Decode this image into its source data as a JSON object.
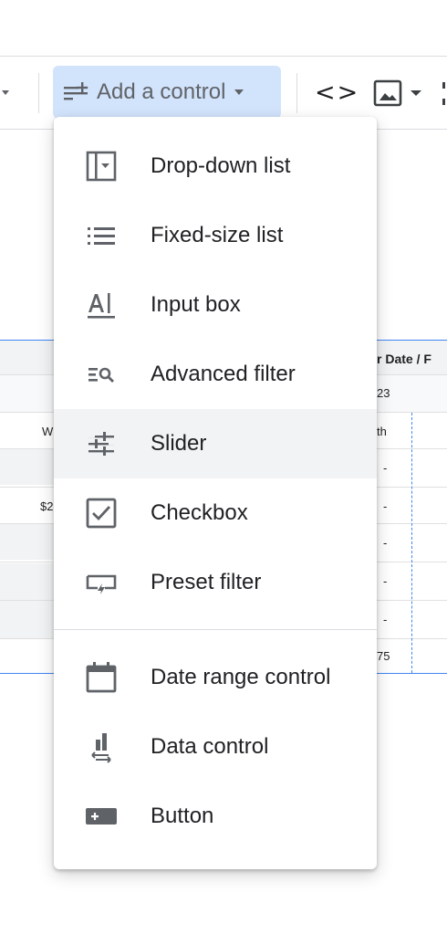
{
  "toolbar": {
    "add_control_label": "Add a control"
  },
  "background_table": {
    "header_fragment": "r Date / F",
    "sub_header_fragment": "23",
    "row_left_fragments": [
      "W",
      "$2"
    ],
    "column_label_fragment": "th",
    "dash_values": [
      "-",
      "-",
      "-",
      "-",
      "-"
    ],
    "last_value_fragment": "75"
  },
  "menu": {
    "items": [
      {
        "label": "Drop-down list",
        "icon": "dropdown-list-icon"
      },
      {
        "label": "Fixed-size list",
        "icon": "fixed-list-icon"
      },
      {
        "label": "Input box",
        "icon": "input-box-icon"
      },
      {
        "label": "Advanced filter",
        "icon": "advanced-filter-icon"
      },
      {
        "label": "Slider",
        "icon": "slider-icon"
      },
      {
        "label": "Checkbox",
        "icon": "checkbox-icon"
      },
      {
        "label": "Preset filter",
        "icon": "preset-filter-icon"
      }
    ],
    "items2": [
      {
        "label": "Date range control",
        "icon": "calendar-icon"
      },
      {
        "label": "Data control",
        "icon": "data-control-icon"
      },
      {
        "label": "Button",
        "icon": "button-icon"
      }
    ]
  },
  "colors": {
    "accent": "#4285f4",
    "button_highlight": "#d2e3fc",
    "icon": "#5f6368"
  }
}
